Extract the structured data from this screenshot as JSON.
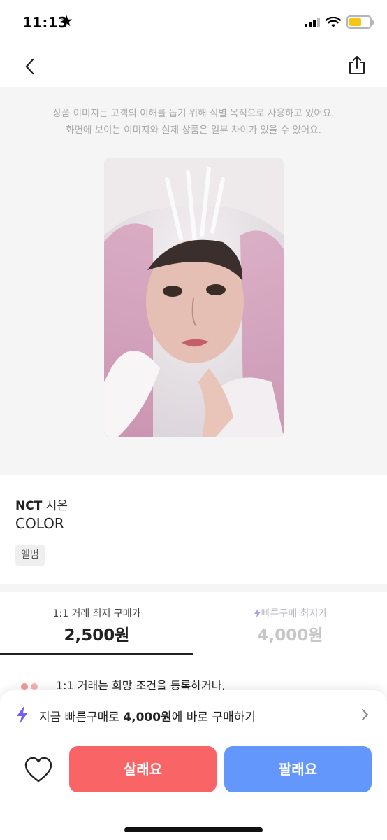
{
  "status_bar": {
    "time": "11:13",
    "star": "★",
    "battery_color": "#f5c518"
  },
  "nav": {
    "back_icon": "chevron-left-icon",
    "share_icon": "share-icon"
  },
  "image_section": {
    "disclaimer_line1": "상품 이미지는 고객의 이해를 돕기 위해 식별 목적으로 사용하고 있어요.",
    "disclaimer_line2": "화면에 보이는 이미지와 실제 상품은 일부 차이가 있을 수 있어요."
  },
  "product": {
    "artist_group": "NCT",
    "artist_member": "시온",
    "album": "COLOR",
    "tag": "앨범"
  },
  "price_tabs": [
    {
      "label": "1:1 거래 최저 구매가",
      "value": "2,500원",
      "active": true
    },
    {
      "label": "빠른구매 최저가",
      "value": "4,000원",
      "active": false
    }
  ],
  "note": {
    "text": "1:1 거래는 희망 조건을 등록하거나,"
  },
  "bottom_bar": {
    "quick_buy_prefix": "지금 빠른구매로 ",
    "quick_buy_price": "4,000원",
    "quick_buy_suffix": "에 바로 구매하기",
    "buy_label": "살래요",
    "sell_label": "팔래요",
    "buy_color": "#f96466",
    "sell_color": "#6497fb",
    "accent_bolt_color": "#7b5cf0"
  }
}
